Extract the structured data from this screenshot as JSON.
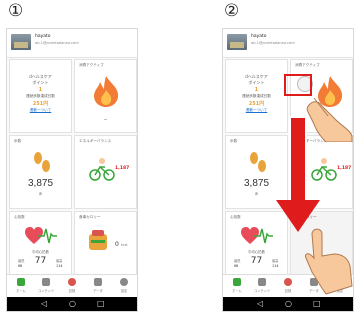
{
  "steps": {
    "first": "①",
    "second": "②"
  },
  "profile": {
    "name": "hayato",
    "email": "ab.1@jcomtadanao.com"
  },
  "cards": {
    "points": {
      "title_line1": "dヘルスケア",
      "title_line2": "ポイント",
      "value": "1",
      "sub": "連続歩数達成日数",
      "total": "251円",
      "link": "連動一ついて"
    },
    "calorie": {
      "title": "消費アクティブ",
      "value": "–"
    },
    "steps": {
      "title": "歩数",
      "value": "3,875",
      "unit": "歩"
    },
    "energy": {
      "title": "エネルギーバランス",
      "value": "1,187"
    },
    "heart": {
      "title": "心拍数",
      "sub": "平均心拍数",
      "value": "77",
      "lo_label": "最低",
      "lo": "68",
      "hi_label": "最高",
      "hi": "114"
    },
    "meal": {
      "title": "食事カロリー",
      "value": "0",
      "unit": "kcal"
    }
  },
  "nav": [
    "ホーム",
    "コンテンツ",
    "記録",
    "データ",
    "設定"
  ],
  "colors": {
    "accent": "#e01b1b",
    "gold": "#e8a33a",
    "green": "#3aa63a",
    "heart": "#e84c5a"
  }
}
